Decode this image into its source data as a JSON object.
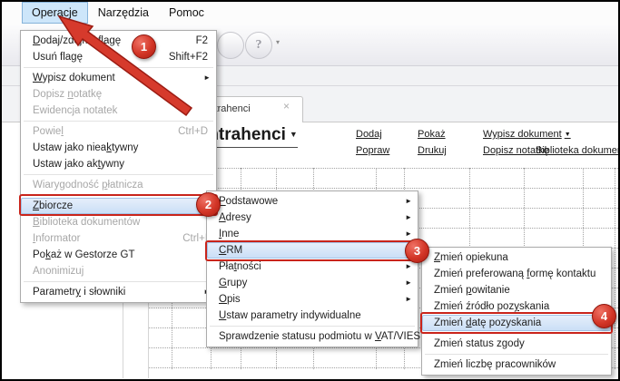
{
  "menubar": {
    "items": [
      {
        "label": "Operacje",
        "selected": true
      },
      {
        "label": "Narzędzia",
        "selected": false
      },
      {
        "label": "Pomoc",
        "selected": false
      }
    ]
  },
  "toolbar": {
    "help_label": "?",
    "dropdown_glyph": "▾"
  },
  "tabs": {
    "active": {
      "label": "Kontrahenci",
      "close_glyph": "×"
    }
  },
  "header": {
    "title": "Kontrahenci",
    "dropdown_glyph": "▼"
  },
  "links": {
    "dodaj": "Dodaj",
    "popraw": "Popraw",
    "pokaz": "Pokaż",
    "drukuj": "Drukuj",
    "wypisz_dokument": "Wypisz dokument",
    "wypisz_dropdown_glyph": "▼",
    "dopisz_notatke": "Dopisz notatkę",
    "biblioteka": "Biblioteka dokumentów"
  },
  "menus": {
    "operacje": {
      "items": [
        {
          "label": "Dodaj/zdejmij flagę",
          "u": 0,
          "shortcut": "F2"
        },
        {
          "label": "Usuń flagę",
          "shortcut": "Shift+F2"
        },
        {
          "sep": true
        },
        {
          "label": "Wypisz dokument",
          "u": 0,
          "arrow": true
        },
        {
          "label": "Dopisz notatkę",
          "u": 7,
          "disabled": true
        },
        {
          "label": "Ewidencja notatek",
          "u": 7,
          "disabled": true
        },
        {
          "sep": true
        },
        {
          "label": "Powiel",
          "u": 5,
          "shortcut": "Ctrl+D",
          "disabled": true
        },
        {
          "label": "Ustaw jako nieaktywny",
          "u": 15
        },
        {
          "label": "Ustaw jako aktywny",
          "u": 13
        },
        {
          "sep": true
        },
        {
          "label": "Wiarygodność płatnicza",
          "u": 13,
          "disabled": true
        },
        {
          "sep": true
        },
        {
          "label": "Zbiorcze",
          "u": 0,
          "selected": true
        },
        {
          "label": "Biblioteka dokumentów",
          "u": 0,
          "disabled": true
        },
        {
          "label": "Informator",
          "u": 0,
          "shortcut": "Ctrl+I",
          "disabled": true
        },
        {
          "label": "Pokaż w Gestorze GT",
          "u": 2
        },
        {
          "label": "Anonimizuj",
          "disabled": true
        },
        {
          "sep": true
        },
        {
          "label": "Parametry i słowniki",
          "u": 8,
          "arrow": true
        }
      ]
    },
    "zbiorcze": {
      "items": [
        {
          "label": "Podstawowe",
          "u": 0,
          "arrow": true
        },
        {
          "label": "Adresy",
          "u": 0,
          "arrow": true
        },
        {
          "label": "Inne",
          "u": 0,
          "arrow": true
        },
        {
          "label": "CRM",
          "u": 0,
          "arrow": true,
          "selected": true
        },
        {
          "label": "Płatności",
          "u": 3,
          "arrow": true
        },
        {
          "label": "Grupy",
          "u": 0,
          "arrow": true
        },
        {
          "label": "Opis",
          "u": 0,
          "arrow": true
        },
        {
          "label": "Ustaw parametry indywidualne",
          "u": 0
        },
        {
          "sep": true
        },
        {
          "label": "Sprawdzenie statusu podmiotu w VAT/VIES",
          "u": 31
        }
      ]
    },
    "crm": {
      "items": [
        {
          "label": "Zmień opiekuna",
          "u": 0
        },
        {
          "label": "Zmień preferowaną formę kontaktu",
          "u": 18
        },
        {
          "label": "Zmień powitanie",
          "u": 6
        },
        {
          "label": "Zmień źródło pozyskania",
          "u": 16
        },
        {
          "label": "Zmień datę pozyskania",
          "u": 6,
          "selected": true
        },
        {
          "sep": true
        },
        {
          "label": "Zmień status zgody"
        },
        {
          "sep": true
        },
        {
          "label": "Zmień liczbę pracowników"
        }
      ]
    }
  },
  "annotations": {
    "steps": [
      "1",
      "2",
      "3",
      "4"
    ],
    "accent": "#c9241b"
  },
  "glyphs": {
    "submenu_arrow": "►"
  }
}
